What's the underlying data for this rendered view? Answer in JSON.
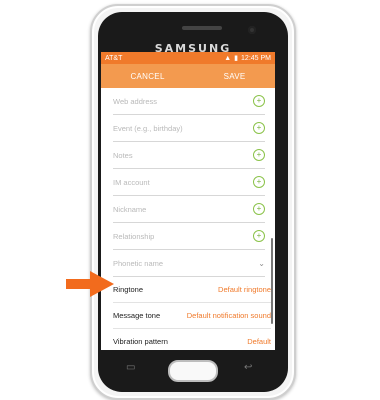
{
  "device": {
    "brand": "SAMSUNG"
  },
  "statusbar": {
    "carrier": "AT&T",
    "time": "12:45 PM"
  },
  "topbar": {
    "cancel_label": "CANCEL",
    "save_label": "SAVE"
  },
  "fields": [
    {
      "placeholder": "Web address"
    },
    {
      "placeholder": "Event (e.g., birthday)"
    },
    {
      "placeholder": "Notes"
    },
    {
      "placeholder": "IM account"
    },
    {
      "placeholder": "Nickname"
    },
    {
      "placeholder": "Relationship"
    },
    {
      "placeholder": "Phonetic name"
    }
  ],
  "settings": [
    {
      "label": "Ringtone",
      "value": "Default ringtone"
    },
    {
      "label": "Message tone",
      "value": "Default notification sound"
    },
    {
      "label": "Vibration pattern",
      "value": "Default"
    }
  ],
  "colors": {
    "accent": "#f07a2b",
    "appbar": "#f39a4f",
    "add_icon": "#7cb342",
    "pointer": "#f26b1d"
  },
  "icons": {
    "add": "plus-circle",
    "expand": "chevron-down",
    "recent_apps": "recent-apps",
    "back": "back-arrow"
  }
}
